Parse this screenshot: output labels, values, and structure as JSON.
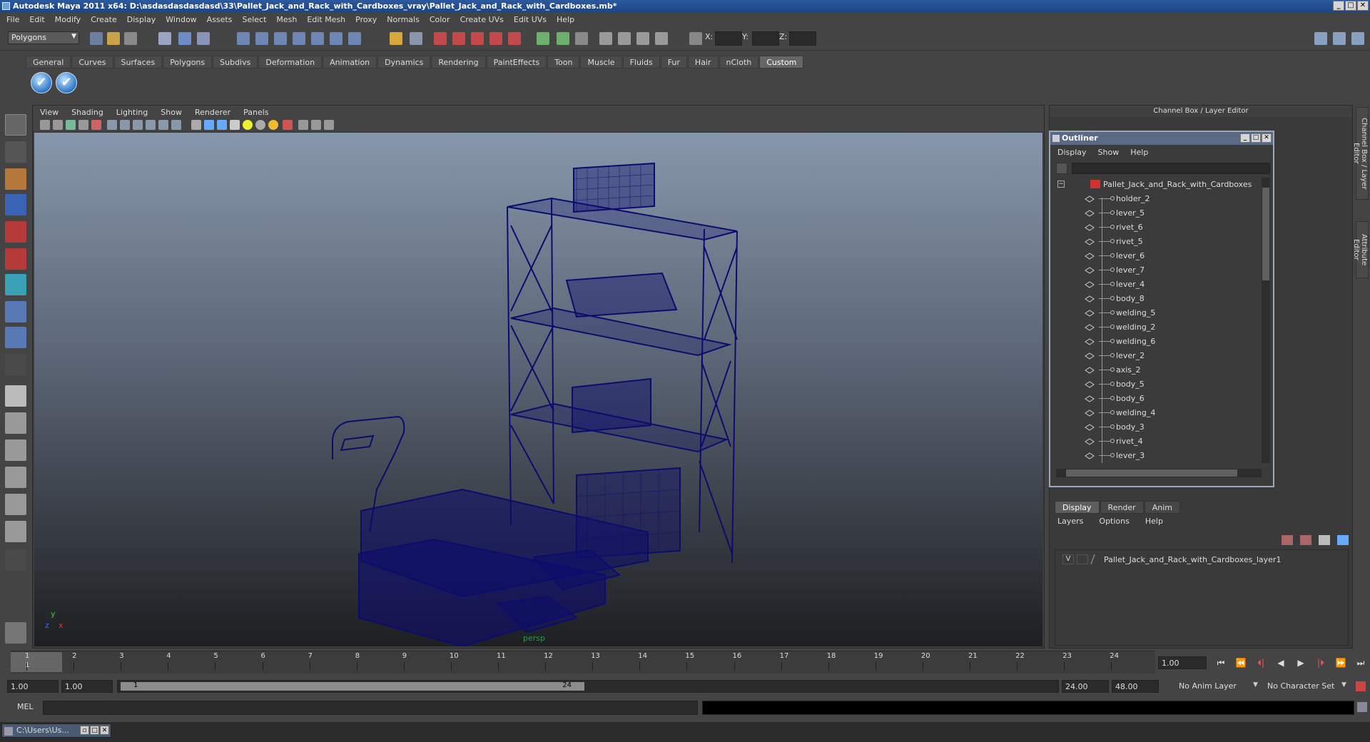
{
  "window": {
    "title": "Autodesk Maya 2011 x64: D:\\asdasdasdasdasd\\33\\Pallet_Jack_and_Rack_with_Cardboxes_vray\\Pallet_Jack_and_Rack_with_Cardboxes.mb*",
    "buttons": [
      "_",
      "□",
      "✕"
    ]
  },
  "menubar": [
    "File",
    "Edit",
    "Modify",
    "Create",
    "Display",
    "Window",
    "Assets",
    "Select",
    "Mesh",
    "Edit Mesh",
    "Proxy",
    "Normals",
    "Color",
    "Create UVs",
    "Edit UVs",
    "Help"
  ],
  "status_line": {
    "mode": "Polygons",
    "x_label": "X:",
    "y_label": "Y:",
    "z_label": "Z:"
  },
  "shelf": {
    "tabs": [
      "General",
      "Curves",
      "Surfaces",
      "Polygons",
      "Subdivs",
      "Deformation",
      "Animation",
      "Dynamics",
      "Rendering",
      "PaintEffects",
      "Toon",
      "Muscle",
      "Fluids",
      "Fur",
      "Hair",
      "nCloth",
      "Custom"
    ],
    "active_tab": "Custom",
    "check_glyph": "✔"
  },
  "viewport": {
    "menu": [
      "View",
      "Shading",
      "Lighting",
      "Show",
      "Renderer",
      "Panels"
    ],
    "camera": "persp",
    "axis_y": "y",
    "axis_x": "x",
    "axis_z": "z",
    "wire_color": "#0c0c6e"
  },
  "channel_box": {
    "title": "Channel Box / Layer Editor",
    "side_tabs": [
      "Channel Box / Layer Editor",
      "Attribute Editor"
    ]
  },
  "outliner": {
    "title": "Outliner",
    "menu": [
      "Display",
      "Show",
      "Help"
    ],
    "root": "Pallet_Jack_and_Rack_with_Cardboxes",
    "items": [
      "holder_2",
      "lever_5",
      "rivet_6",
      "rivet_5",
      "lever_6",
      "lever_7",
      "lever_4",
      "body_8",
      "welding_5",
      "welding_2",
      "welding_6",
      "lever_2",
      "axis_2",
      "body_5",
      "body_6",
      "welding_4",
      "body_3",
      "rivet_4",
      "lever_3"
    ]
  },
  "layer_editor": {
    "tabs": [
      "Display",
      "Render",
      "Anim"
    ],
    "active_tab": "Display",
    "menu": [
      "Layers",
      "Options",
      "Help"
    ],
    "layers": [
      {
        "visible": "V",
        "name": "Pallet_Jack_and_Rack_with_Cardboxes_layer1"
      }
    ]
  },
  "time_slider": {
    "ticks": [
      "1",
      "2",
      "3",
      "4",
      "5",
      "6",
      "7",
      "8",
      "9",
      "10",
      "11",
      "12",
      "13",
      "14",
      "15",
      "16",
      "17",
      "18",
      "19",
      "20",
      "21",
      "22",
      "23",
      "24"
    ],
    "current_frame": "1",
    "current_time_field": "1.00",
    "playback_glyphs": [
      "⏮",
      "⏪",
      "⏴|",
      "◀",
      "▶",
      "|⏵",
      "⏩",
      "⏭"
    ]
  },
  "range_slider": {
    "start_time": "1.00",
    "playback_start": "1.00",
    "bar_start": "1",
    "bar_end": "24",
    "playback_end": "24.00",
    "end_time": "48.00",
    "anim_layer": "No Anim Layer",
    "character_set": "No Character Set"
  },
  "command_line": {
    "label": "MEL"
  },
  "taskbar": {
    "item": "C:\\Users\\Us..."
  }
}
